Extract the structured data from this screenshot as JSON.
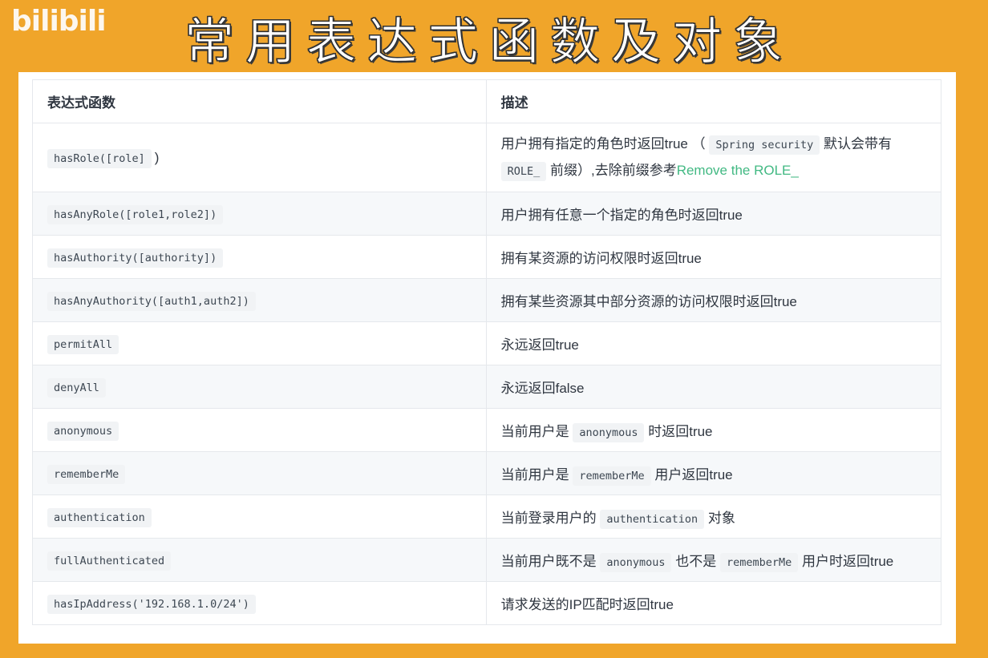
{
  "logo": "bilibili",
  "banner": "常用表达式函数及对象",
  "table": {
    "headers": [
      "表达式函数",
      "描述"
    ],
    "rows": [
      {
        "code": "hasRole([role]",
        "suffix": ")",
        "d1": "用户拥有指定的角色时返回true （",
        "d2": "Spring security",
        "d3": "默认会带有",
        "d4": "ROLE_",
        "d5": "前缀）,去除前缀参考",
        "link": "Remove the ROLE_"
      },
      {
        "code": "hasAnyRole([role1,role2])",
        "desc": "用户拥有任意一个指定的角色时返回true"
      },
      {
        "code": "hasAuthority([authority])",
        "desc": "拥有某资源的访问权限时返回true"
      },
      {
        "code": "hasAnyAuthority([auth1,auth2])",
        "desc": "拥有某些资源其中部分资源的访问权限时返回true"
      },
      {
        "code": "permitAll",
        "desc": "永远返回true"
      },
      {
        "code": "denyAll",
        "desc": "永远返回false"
      },
      {
        "code": "anonymous",
        "pre": "当前用户是",
        "mid": "anonymous",
        "post": "时返回true"
      },
      {
        "code": "rememberMe",
        "pre": "当前用户是",
        "mid": "rememberMe",
        "post": "用户返回true"
      },
      {
        "code": "authentication",
        "pre": "当前登录用户的",
        "mid": "authentication",
        "post": "对象"
      },
      {
        "code": "fullAuthenticated",
        "pre": "当前用户既不是",
        "mid": "anonymous",
        "post": "也不是",
        "mid2": "rememberMe",
        "post2": "用户时返回true"
      },
      {
        "code": "hasIpAddress('192.168.1.0/24')",
        "desc": "请求发送的IP匹配时返回true"
      }
    ]
  }
}
